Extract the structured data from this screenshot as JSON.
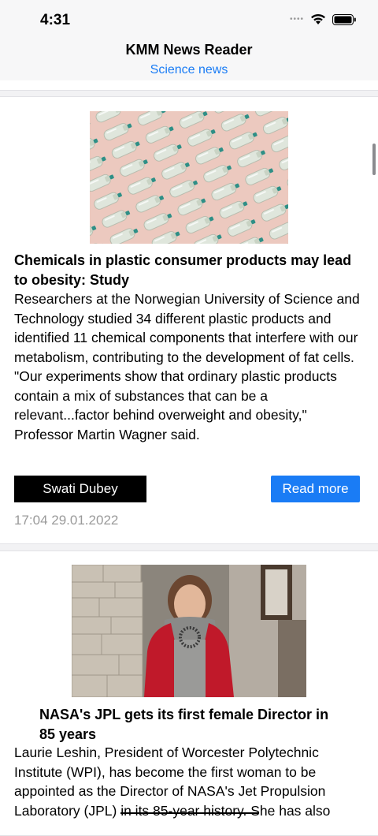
{
  "status_bar": {
    "time": "4:31",
    "signal_icon": "cellular-dots-icon",
    "wifi_icon": "wifi-icon",
    "battery_icon": "battery-icon"
  },
  "nav": {
    "title": "KMM News Reader",
    "subtitle": "Science news"
  },
  "articles": [
    {
      "image": "plastic-bottles-pattern-image",
      "title": "Chemicals in plastic consumer products may lead to obesity: Study",
      "body": "Researchers at the Norwegian University of Science and Technology studied 34 different plastic products and identified 11 chemical components that interfere with our metabolism, contributing to the development of fat cells. \"Our experiments show that ordinary plastic products contain a mix of substances that can be a relevant...factor behind overweight and obesity,\" Professor Martin Wagner said.",
      "author": "Swati Dubey",
      "read_more": "Read more",
      "date": "17:04 29.01.2022"
    },
    {
      "image": "woman-portrait-red-jacket-image",
      "title": "NASA's JPL gets its first female Director in 85 years",
      "body": "Laurie Leshin, President of Worcester Polytechnic Institute (WPI), has become the first woman to be appointed as the Director of NASA's Jet Propulsion Laboratory (JPL) in its 85-year history. She has also"
    }
  ],
  "colors": {
    "accent": "#1a7cf5",
    "author_chip_bg": "#000000",
    "date_text": "#9a9a9a"
  }
}
